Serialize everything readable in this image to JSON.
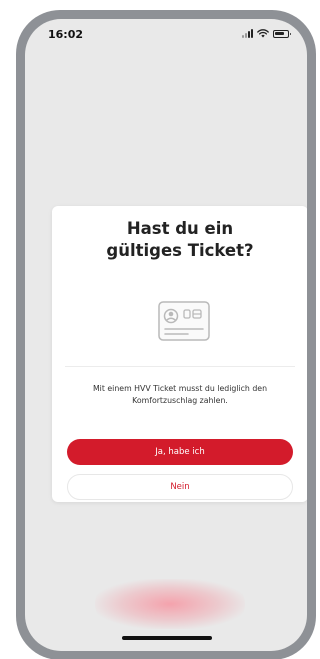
{
  "status_bar": {
    "time": "16:02",
    "icons": [
      "signal-icon",
      "wifi-icon",
      "battery-icon"
    ]
  },
  "dialog": {
    "title_line1": "Hast du ein",
    "title_line2": "gültiges Ticket?",
    "illustration": "ticket-card-icon",
    "message": "Mit einem HVV Ticket musst du lediglich den Komfortzuschlag zahlen.",
    "primary_button": "Ja, habe ich",
    "secondary_button": "Nein"
  },
  "colors": {
    "accent": "#d31b2b",
    "frame": "#8e9196",
    "overlay": "#e9e9e9"
  }
}
